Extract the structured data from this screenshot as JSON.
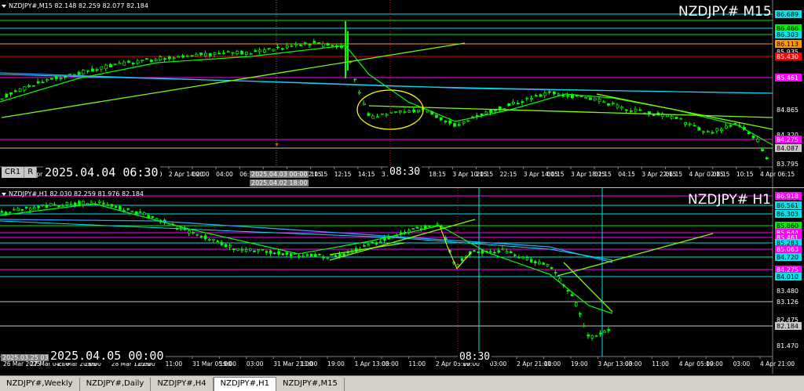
{
  "top_chart": {
    "header": "NZDJPY#,M15  82.148 82.259 82.077 82.184",
    "symbol_label": "NZDJPY# M15",
    "big_time": "2025.04.04 06:30",
    "crosshair_time_label": "2025.04.03 00:00",
    "crosshair_time_label2": "2025.04.02 18:00",
    "cursor_time": "08:30",
    "cr_buttons": [
      "CR1",
      "R"
    ],
    "price_labels": [
      {
        "text": "86.689",
        "bg": "#00e5ee",
        "fg": "#000"
      },
      {
        "text": "86.466",
        "bg": "#00ee00",
        "fg": "#000"
      },
      {
        "text": "86.303",
        "bg": "#00e5ee",
        "fg": "#000"
      },
      {
        "text": "86.113",
        "bg": "#ff9900",
        "fg": "#000"
      },
      {
        "text": "85.935",
        "bg": "#000",
        "fg": "#ffffff"
      },
      {
        "text": "85.430",
        "bg": "#ff0000",
        "fg": "#ffffff"
      },
      {
        "text": "85.461",
        "bg": "#ff00ff",
        "fg": "#ffffff"
      },
      {
        "text": "84.865",
        "bg": "#000",
        "fg": "#ffffff"
      },
      {
        "text": "84.320",
        "bg": "#000",
        "fg": "#ffffff"
      },
      {
        "text": "84.275",
        "bg": "#ff00ff",
        "fg": "#ffffff"
      },
      {
        "text": "84.087",
        "bg": "#c8c8c8",
        "fg": "#000"
      },
      {
        "text": "83.795",
        "bg": "#000",
        "fg": "#ffffff"
      }
    ],
    "time_labels": [
      "1 Apr 2025",
      "2 Apr 02:00",
      "2 Apr 06:00",
      "2 Apr 10:00",
      "16:00",
      "18:00",
      "20:00",
      "2 Apr 14:00",
      "02:00",
      "04:00",
      "06:15",
      "08:30",
      "3 Apr 02:15",
      "10:15",
      "12:15",
      "14:15",
      "3 Apr 06:15",
      "16:15",
      "18:15",
      "3 Apr 10:15",
      "20:15",
      "22:15",
      "3 Apr 14:15",
      "00:15",
      "3 Apr 18:15",
      "02:15",
      "04:15",
      "3 Apr 22:15",
      "06:15",
      "4 Apr 02:15",
      "08:15",
      "10:15",
      "4 Apr 06:15"
    ]
  },
  "bottom_chart": {
    "header": "NZDJPY#,H1  82.030 82.259 81.976 82.184",
    "symbol_label": "NZDJPY# H1",
    "big_time": "2025.04.05 00:00",
    "crosshair_time_label": "2025.03.25 03:00",
    "cursor_time": "08:30",
    "price_labels": [
      {
        "text": "86.918",
        "bg": "#ff00ff",
        "fg": "#ffffff"
      },
      {
        "text": "86.561",
        "bg": "#00e5ee",
        "fg": "#000"
      },
      {
        "text": "86.303",
        "bg": "#00e5ee",
        "fg": "#000"
      },
      {
        "text": "85.860",
        "bg": "#00ee00",
        "fg": "#000"
      },
      {
        "text": "85.644",
        "bg": "#ff00ff",
        "fg": "#ffffff"
      },
      {
        "text": "85.461",
        "bg": "#ff00ff",
        "fg": "#ffffff"
      },
      {
        "text": "85.283",
        "bg": "#00e5ee",
        "fg": "#000"
      },
      {
        "text": "85.063",
        "bg": "#ff00ff",
        "fg": "#ffffff"
      },
      {
        "text": "84.720",
        "bg": "#00e5ee",
        "fg": "#000"
      },
      {
        "text": "84.275",
        "bg": "#ff00ff",
        "fg": "#ffffff"
      },
      {
        "text": "84.010",
        "bg": "#00e5ee",
        "fg": "#000"
      },
      {
        "text": "83.480",
        "bg": "#000",
        "fg": "#ffffff"
      },
      {
        "text": "83.126",
        "bg": "#000",
        "fg": "#ffffff"
      },
      {
        "text": "82.475",
        "bg": "#000",
        "fg": "#ffffff"
      },
      {
        "text": "82.184",
        "bg": "#c8c8c8",
        "fg": "#000"
      },
      {
        "text": "81.470",
        "bg": "#000",
        "fg": "#ffffff"
      }
    ],
    "time_labels": [
      "26 Mar 2025",
      "27 Mar 04:00",
      "27 Mar 20:00",
      "18:00",
      "28 Mar 12:00",
      "02:00",
      "11:00",
      "31 Mar 05:00",
      "19:00",
      "03:00",
      "31 Mar 21:00",
      "11:00",
      "19:00",
      "1 Apr 13:00",
      "03:00",
      "11:00",
      "2 Apr 05:00",
      "19:00",
      "03:00",
      "2 Apr 21:00",
      "11:00",
      "19:00",
      "3 Apr 13:00",
      "03:00",
      "11:00",
      "4 Apr 05:00",
      "19:00",
      "03:00",
      "4 Apr 21:00"
    ]
  },
  "tabs": [
    {
      "label": "NZDJPY#,Weekly",
      "active": false
    },
    {
      "label": "NZDJPY#,Daily",
      "active": false
    },
    {
      "label": "NZDJPY#,H4",
      "active": false
    },
    {
      "label": "NZDJPY#,H1",
      "active": true
    },
    {
      "label": "NZDJPY#,M15",
      "active": false
    }
  ]
}
